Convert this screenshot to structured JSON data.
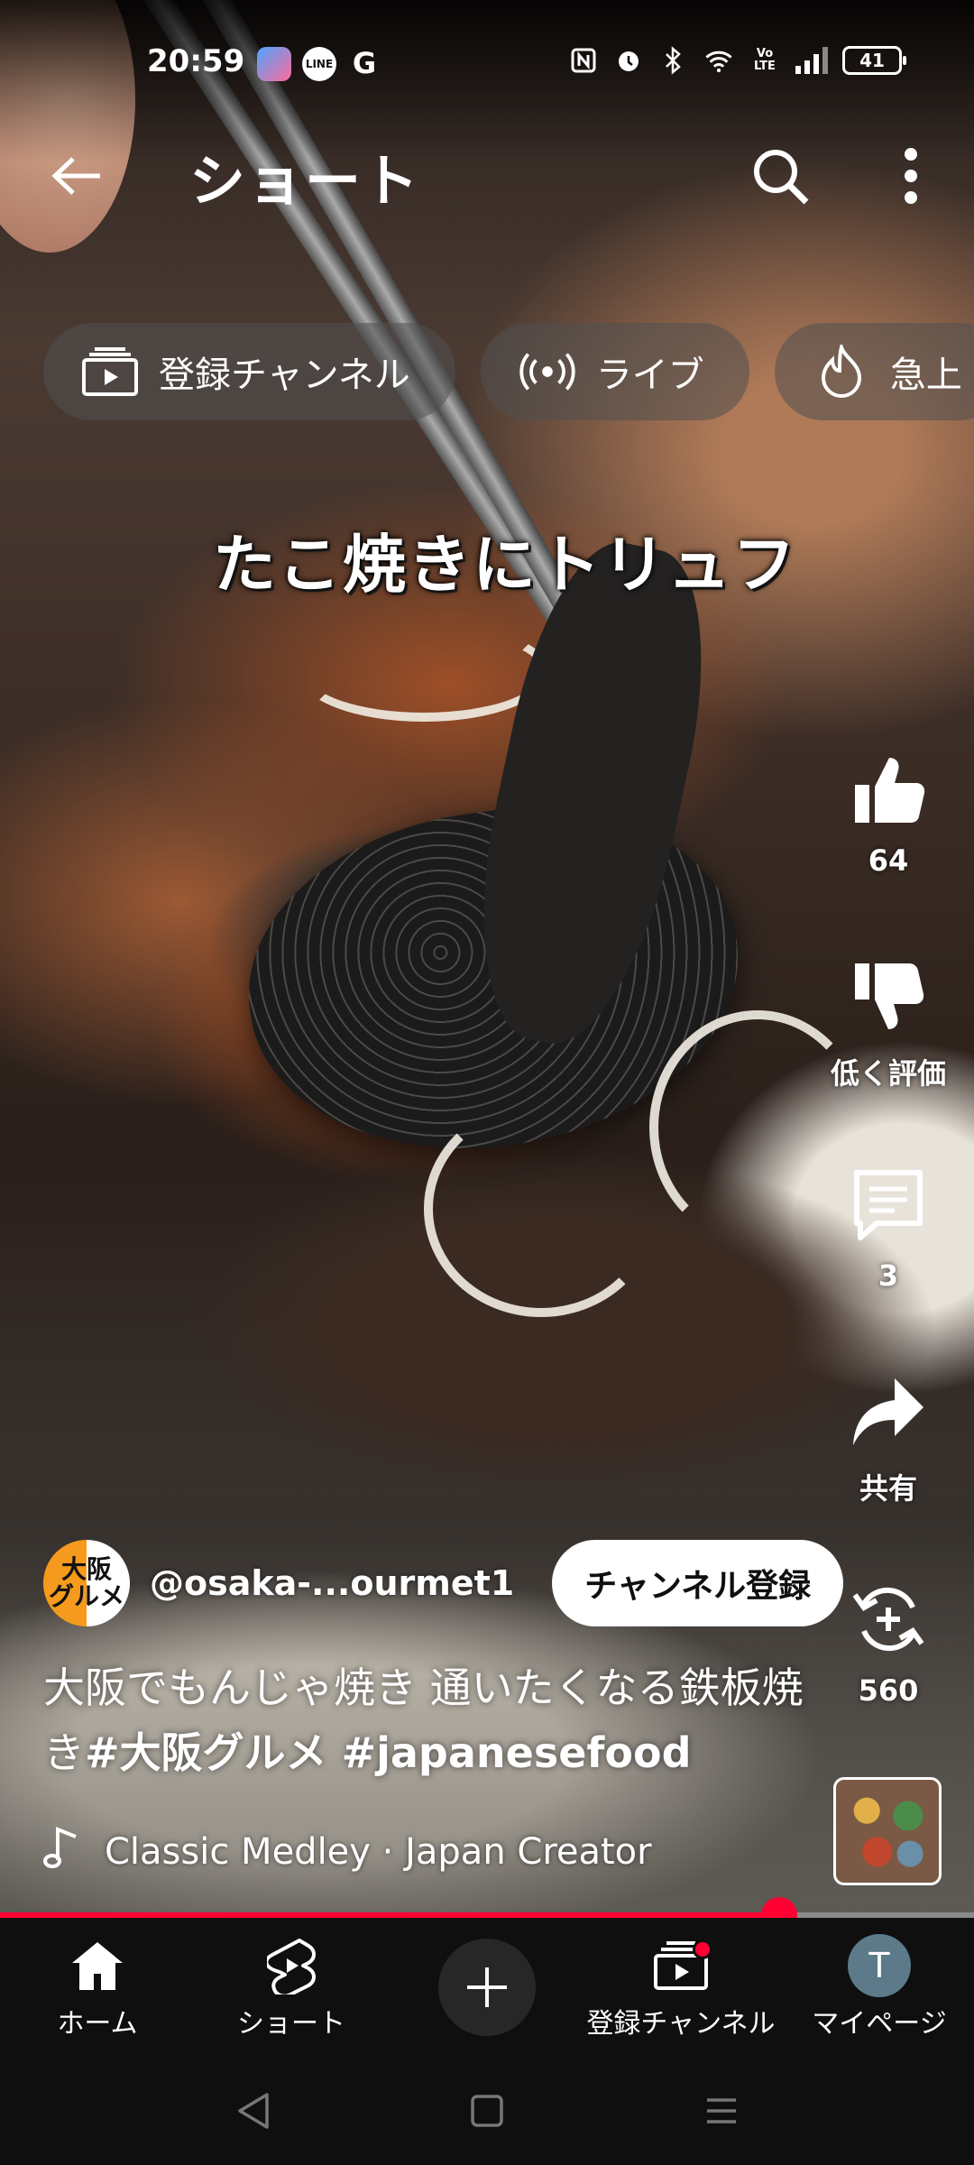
{
  "status_bar": {
    "time": "20:59",
    "app_icons": [
      "app-icon",
      "line-icon",
      "google-icon"
    ],
    "line_label": "LINE",
    "google_label": "G",
    "network_label": "Vo LTE",
    "battery": "41"
  },
  "header": {
    "title": "ショート"
  },
  "chips": [
    {
      "label": "登録チャンネル",
      "icon": "subscriptions-icon"
    },
    {
      "label": "ライブ",
      "icon": "live-icon"
    },
    {
      "label": "急上",
      "icon": "trending-icon"
    }
  ],
  "video": {
    "caption": "たこ焼きにトリュフ"
  },
  "actions": {
    "like_count": "64",
    "dislike_label": "低く評価",
    "comment_count": "3",
    "share_label": "共有",
    "remix_count": "560"
  },
  "channel": {
    "avatar_text_1": "大阪",
    "avatar_text_2": "グルメ",
    "handle": "@osaka-...ourmet1",
    "subscribe_label": "チャンネル登録"
  },
  "description": {
    "text": "大阪でもんじゃ焼き 通いたくなる鉄板焼き",
    "tags": "#大阪グルメ #japanesefood"
  },
  "music": {
    "label": "Classic Medley · Japan Creator"
  },
  "progress": {
    "percent": 80
  },
  "bottom_nav": {
    "home": "ホーム",
    "shorts": "ショート",
    "subscriptions": "登録チャンネル",
    "you": "マイページ",
    "you_initial": "T"
  },
  "colors": {
    "accent": "#ff0033",
    "nav_bg": "#0f0f0f",
    "chip_bg": "rgba(80,80,80,0.55)"
  }
}
